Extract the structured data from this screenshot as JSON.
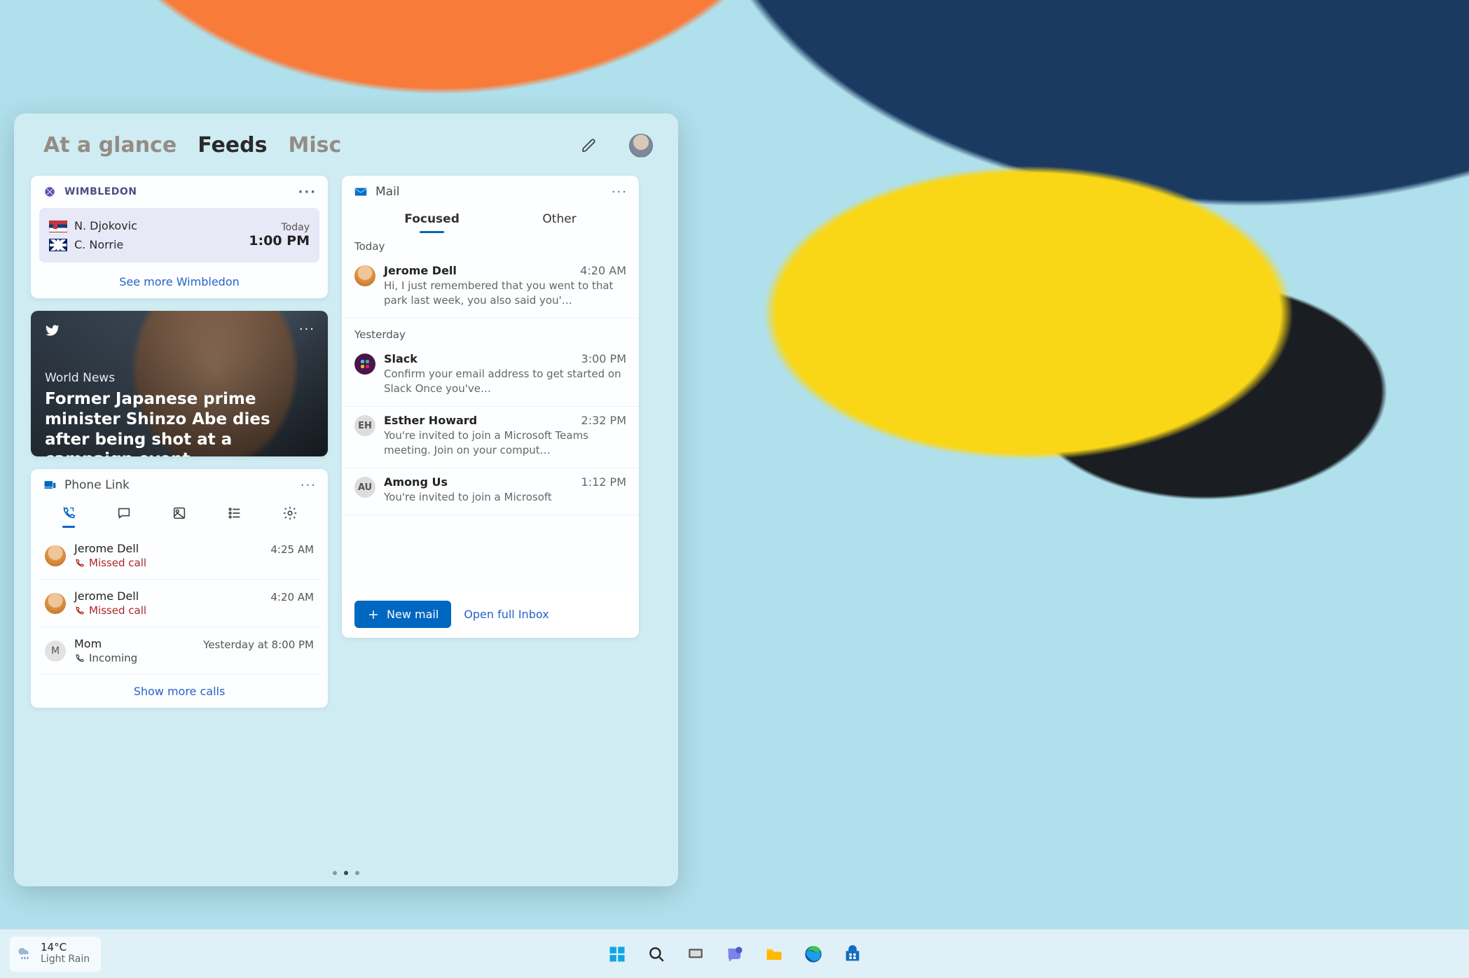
{
  "widgets": {
    "tabs": [
      "At a glance",
      "Feeds",
      "Misc"
    ],
    "active_tab": 1
  },
  "wimbledon": {
    "title": "WIMBLEDON",
    "players": [
      {
        "flag": "rs",
        "name": "N. Djokovic"
      },
      {
        "flag": "gb",
        "name": "C. Norrie"
      }
    ],
    "day_label": "Today",
    "time": "1:00 PM",
    "more_link": "See more Wimbledon"
  },
  "news": {
    "source": "twitter",
    "category": "World News",
    "headline": "Former Japanese prime minister Shinzo Abe dies after being shot at a campaign event"
  },
  "phonelink": {
    "title": "Phone Link",
    "tabs": [
      "calls",
      "messages",
      "photos",
      "tasks",
      "settings"
    ],
    "active_tab": 0,
    "calls": [
      {
        "avatar": "photo",
        "initials": "",
        "name": "Jerome Dell",
        "status": "Missed call",
        "status_kind": "missed",
        "time": "4:25 AM"
      },
      {
        "avatar": "photo",
        "initials": "",
        "name": "Jerome Dell",
        "status": "Missed call",
        "status_kind": "missed",
        "time": "4:20 AM"
      },
      {
        "avatar": "letter",
        "initials": "M",
        "name": "Mom",
        "status": "Incoming",
        "status_kind": "incoming",
        "time": "Yesterday at 8:00 PM"
      }
    ],
    "show_more": "Show more calls"
  },
  "mail": {
    "title": "Mail",
    "tabs": [
      "Focused",
      "Other"
    ],
    "active_tab": 0,
    "sections": [
      {
        "heading": "Today",
        "items": [
          {
            "avatar": "jerome",
            "initials": "",
            "from": "Jerome Dell",
            "time": "4:20 AM",
            "preview": "Hi, I just remembered that you went to that park last week, you also said you'…"
          }
        ]
      },
      {
        "heading": "Yesterday",
        "items": [
          {
            "avatar": "slack",
            "initials": "",
            "from": "Slack",
            "time": "3:00 PM",
            "preview": "Confirm your email address to get started on Slack Once you've…"
          },
          {
            "avatar": "letter",
            "initials": "EH",
            "from": "Esther Howard",
            "time": "2:32 PM",
            "preview": "You're invited to join a Microsoft Teams meeting. Join on your comput…"
          },
          {
            "avatar": "letter",
            "initials": "AU",
            "from": "Among Us",
            "time": "1:12 PM",
            "preview": "You're invited to join a Microsoft"
          }
        ]
      }
    ],
    "new_mail_label": "New mail",
    "open_inbox_label": "Open full Inbox"
  },
  "page_indicator": {
    "count": 3,
    "active": 1
  },
  "taskbar": {
    "weather": {
      "temp": "14°C",
      "condition": "Light Rain"
    },
    "apps": [
      "start",
      "search",
      "taskview",
      "chat",
      "explorer",
      "edge",
      "store"
    ]
  }
}
